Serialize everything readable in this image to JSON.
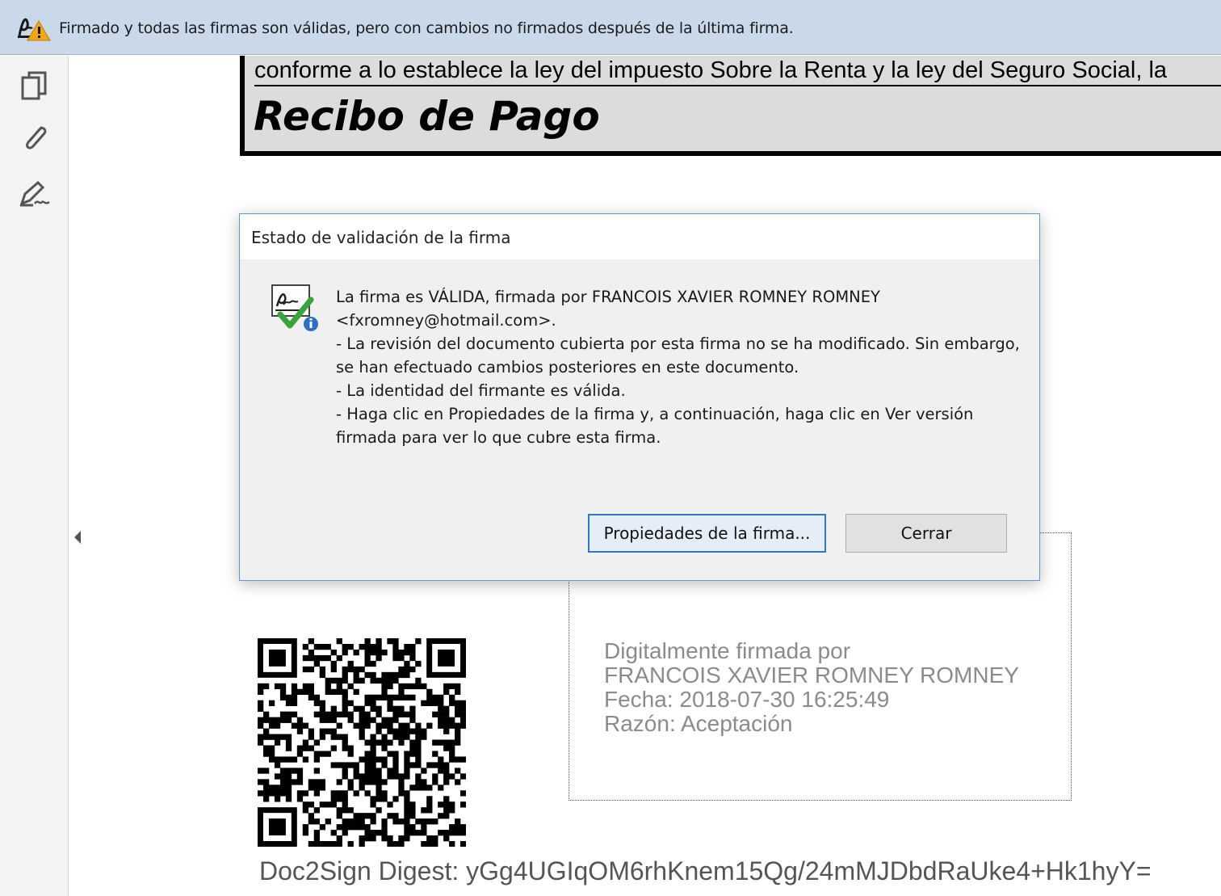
{
  "signature_bar": {
    "icon": "signature-warning-icon",
    "message": "Firmado y todas las firmas son válidas, pero con cambios no firmados después de la última firma."
  },
  "nav": {
    "items": [
      {
        "icon": "pages-icon"
      },
      {
        "icon": "attachment-icon"
      },
      {
        "icon": "signatures-icon"
      }
    ],
    "collapse_icon": "collapse-left-icon"
  },
  "document": {
    "header_line": "conforme a lo establece la ley del impuesto Sobre la Renta y la ley del Seguro Social, la",
    "title": "Recibo de Pago",
    "signature_field": {
      "line1": "Digitalmente firmada por",
      "line2": "FRANCOIS XAVIER ROMNEY ROMNEY",
      "line3": "Fecha: 2018-07-30 16:25:49",
      "line4": "Razón: Aceptación"
    },
    "digest": "Doc2Sign Digest: yGg4UGIqOM6rhKnem15Qg/24mMJDbdRaUke4+Hk1hyY="
  },
  "dialog": {
    "title": "Estado de validación de la firma",
    "icon": "valid-signature-icon",
    "lines": [
      "La firma es VÁLIDA, firmada por FRANCOIS XAVIER ROMNEY ROMNEY",
      "<fxromney@hotmail.com>.",
      "- La revisión del documento cubierta por esta firma no se ha modificado. Sin embargo,",
      "se han efectuado cambios posteriores en este documento.",
      "- La identidad del firmante es válida.",
      "- Haga clic en Propiedades de la firma y, a continuación, haga clic en Ver versión",
      "firmada para ver lo que cubre esta firma."
    ],
    "properties_button": "Propiedades de la firma...",
    "close_button": "Cerrar"
  }
}
